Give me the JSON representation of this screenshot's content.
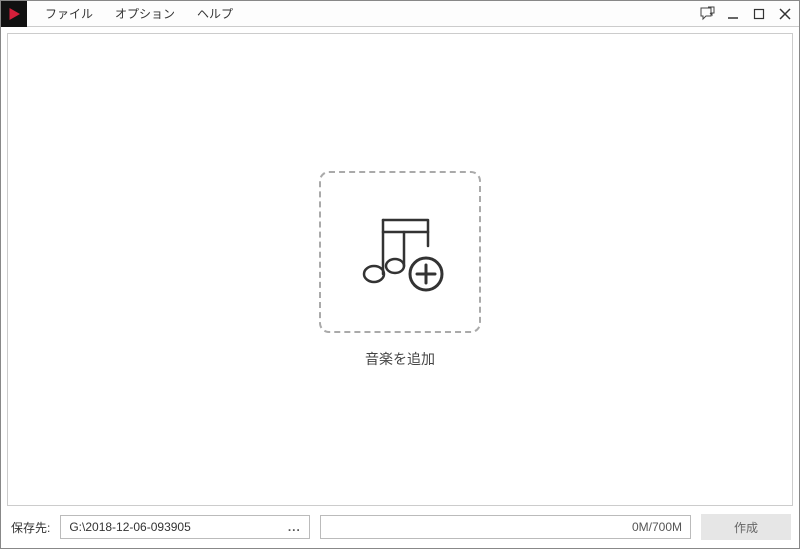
{
  "menu": {
    "file": "ファイル",
    "options": "オプション",
    "help": "ヘルプ"
  },
  "dropzone": {
    "label": "音楽を追加"
  },
  "footer": {
    "save_to_label": "保存先:",
    "save_path": "G:\\2018-12-06-093905",
    "browse": "...",
    "capacity": "0M/700M",
    "create_label": "作成"
  }
}
